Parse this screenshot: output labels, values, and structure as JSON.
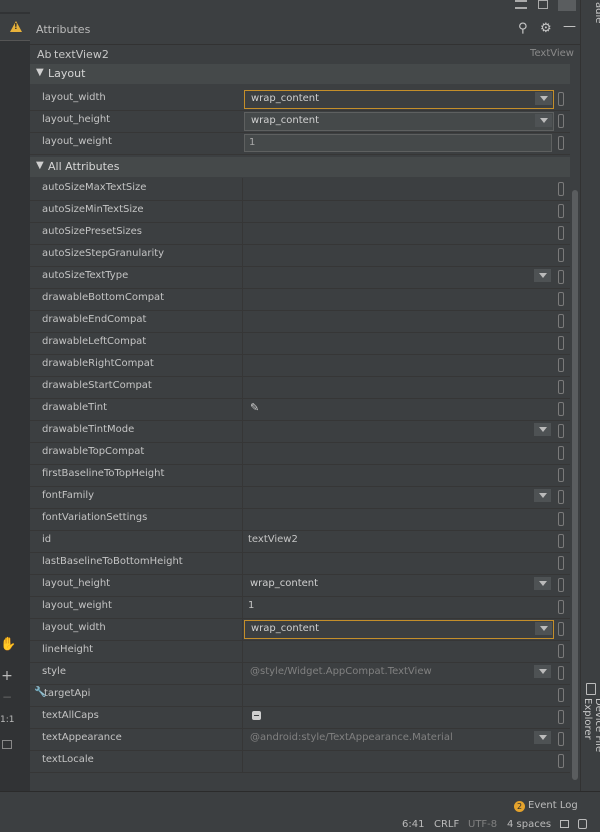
{
  "header": {
    "title": "Attributes",
    "icons": [
      "search-icon",
      "gear-icon",
      "minimize-icon"
    ]
  },
  "top_icons": [
    "menu-icon",
    "split-view-icon",
    "preview-icon"
  ],
  "right_strip": {
    "top_label": "adle",
    "device_explorer": "Device File Explorer"
  },
  "component": {
    "prefix": "Ab",
    "name": "textView2",
    "type": "TextView"
  },
  "layout_section": {
    "label": "Layout",
    "rows": [
      {
        "name": "layout_width",
        "value": "wrap_content",
        "kind": "combo-focus"
      },
      {
        "name": "layout_height",
        "value": "wrap_content",
        "kind": "combo-box"
      },
      {
        "name": "layout_weight",
        "value": "1",
        "kind": "text"
      }
    ]
  },
  "all_section": {
    "label": "All Attributes",
    "rows": [
      {
        "name": "autoSizeMaxTextSize",
        "value": ""
      },
      {
        "name": "autoSizeMinTextSize",
        "value": ""
      },
      {
        "name": "autoSizePresetSizes",
        "value": ""
      },
      {
        "name": "autoSizeStepGranularity",
        "value": ""
      },
      {
        "name": "autoSizeTextType",
        "value": "",
        "kind": "dropdown"
      },
      {
        "name": "drawableBottomCompat",
        "value": ""
      },
      {
        "name": "drawableEndCompat",
        "value": ""
      },
      {
        "name": "drawableLeftCompat",
        "value": ""
      },
      {
        "name": "drawableRightCompat",
        "value": ""
      },
      {
        "name": "drawableStartCompat",
        "value": ""
      },
      {
        "name": "drawableTint",
        "value": "",
        "kind": "picker"
      },
      {
        "name": "drawableTintMode",
        "value": "",
        "kind": "dropdown"
      },
      {
        "name": "drawableTopCompat",
        "value": ""
      },
      {
        "name": "firstBaselineToTopHeight",
        "value": ""
      },
      {
        "name": "fontFamily",
        "value": "",
        "kind": "dropdown"
      },
      {
        "name": "fontVariationSettings",
        "value": ""
      },
      {
        "name": "id",
        "value": "textView2"
      },
      {
        "name": "lastBaselineToBottomHeight",
        "value": ""
      },
      {
        "name": "layout_height",
        "value": "wrap_content",
        "kind": "dropdown"
      },
      {
        "name": "layout_weight",
        "value": "1"
      },
      {
        "name": "layout_width",
        "value": "wrap_content",
        "kind": "dropdown-focus"
      },
      {
        "name": "lineHeight",
        "value": ""
      },
      {
        "name": "style",
        "value": "@style/Widget.AppCompat.TextView",
        "kind": "dropdown-grey"
      },
      {
        "name": "targetApi",
        "value": "",
        "kind": "wrench"
      },
      {
        "name": "textAllCaps",
        "value": "",
        "kind": "checkbox"
      },
      {
        "name": "textAppearance",
        "value": "@android:style/TextAppearance.Material",
        "kind": "dropdown-grey"
      },
      {
        "name": "textLocale",
        "value": ""
      }
    ]
  },
  "left_tools": [
    "hand-icon",
    "zoom-in-icon",
    "zoom-out-icon",
    "actual-size-icon",
    "fit-screen-icon"
  ],
  "left_tools_label": "1:1",
  "status": {
    "event_log_count": "2",
    "event_log": "Event Log",
    "position": "6:41",
    "line_sep": "CRLF",
    "encoding": "UTF-8",
    "indent": "4 spaces"
  }
}
